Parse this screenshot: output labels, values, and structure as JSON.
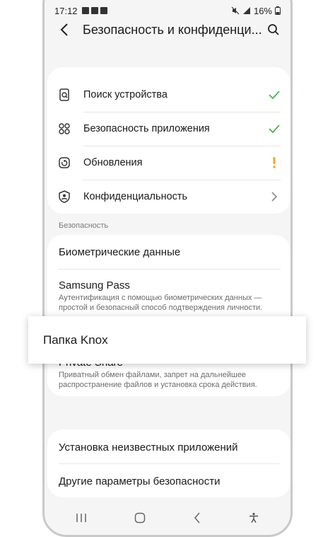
{
  "status_bar": {
    "time": "17:12",
    "battery": "16%"
  },
  "header": {
    "title": "Безопасность и конфиденци..."
  },
  "top_items": [
    {
      "label": "Поиск устройства",
      "icon": "find-device-icon",
      "status": "check"
    },
    {
      "label": "Безопасность приложения",
      "icon": "app-security-icon",
      "status": "check"
    },
    {
      "label": "Обновления",
      "icon": "updates-icon",
      "status": "warning"
    },
    {
      "label": "Конфиденциальность",
      "icon": "privacy-shield-icon",
      "status": "chevron"
    }
  ],
  "security_section": {
    "label": "Безопасность",
    "biometrics": "Биометрические данные",
    "samsung_pass": {
      "title": "Samsung Pass",
      "description": "Аутентификация с помощью биометрических данных — простой и безопасный способ подтверждения личности."
    },
    "knox": "Папка Knox",
    "private_share": {
      "title": "Private Share",
      "description": "Приватный обмен файлами, запрет на дальнейшее распространение файлов и установка срока действия."
    }
  },
  "other_section": {
    "unknown_apps": "Установка неизвестных приложений",
    "other_settings": "Другие параметры безопасности"
  },
  "colors": {
    "check": "#4caf50",
    "warning": "#f5a623",
    "background": "#f5f5f5",
    "card": "#ffffff"
  }
}
